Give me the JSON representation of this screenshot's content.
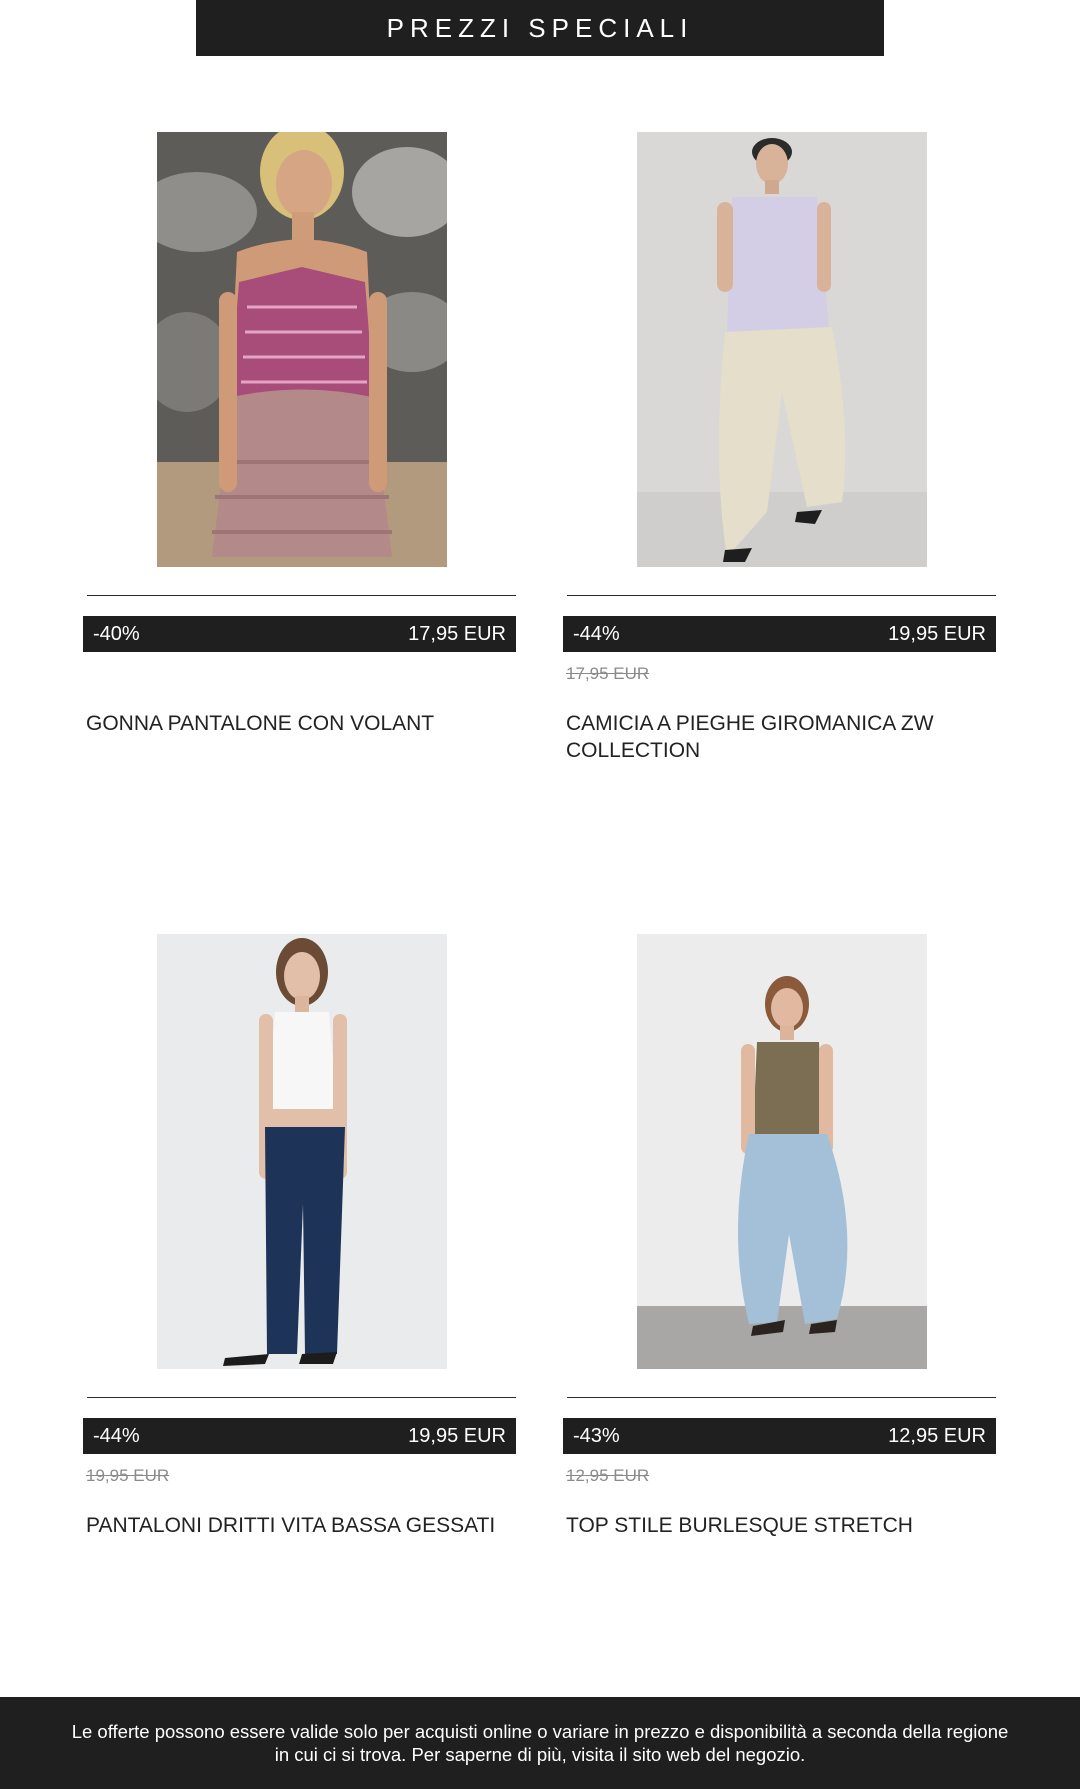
{
  "header": {
    "title": "PREZZI SPECIALI"
  },
  "products": [
    {
      "name": "GONNA PANTALONE CON VOLANT",
      "discount": "-40%",
      "price": "17,95 EUR",
      "old_price": "",
      "image": "model-pink-halter-top-ruffle-shorts"
    },
    {
      "name": "CAMICIA A PIEGHE GIROMANICA ZW COLLECTION",
      "discount": "-44%",
      "price": "19,95 EUR",
      "old_price": "17,95 EUR",
      "image": "model-lilac-shirt-beige-trousers"
    },
    {
      "name": "PANTALONI DRITTI VITA BASSA GESSATI",
      "discount": "-44%",
      "price": "19,95 EUR",
      "old_price": "19,95 EUR",
      "image": "model-white-tank-navy-trousers"
    },
    {
      "name": "TOP STILE BURLESQUE STRETCH",
      "discount": "-43%",
      "price": "12,95 EUR",
      "old_price": "12,95 EUR",
      "image": "model-khaki-top-light-jeans"
    }
  ],
  "footer": {
    "disclaimer": "Le offerte possono essere valide solo per acquisti online o variare in prezzo e disponibilità a seconda della regione in cui ci si trova. Per saperne di più, visita il sito web del negozio."
  },
  "colors": {
    "dark": "#1f1f1f",
    "text": "#222222",
    "muted": "#8a8a8a",
    "background": "#ffffff"
  }
}
